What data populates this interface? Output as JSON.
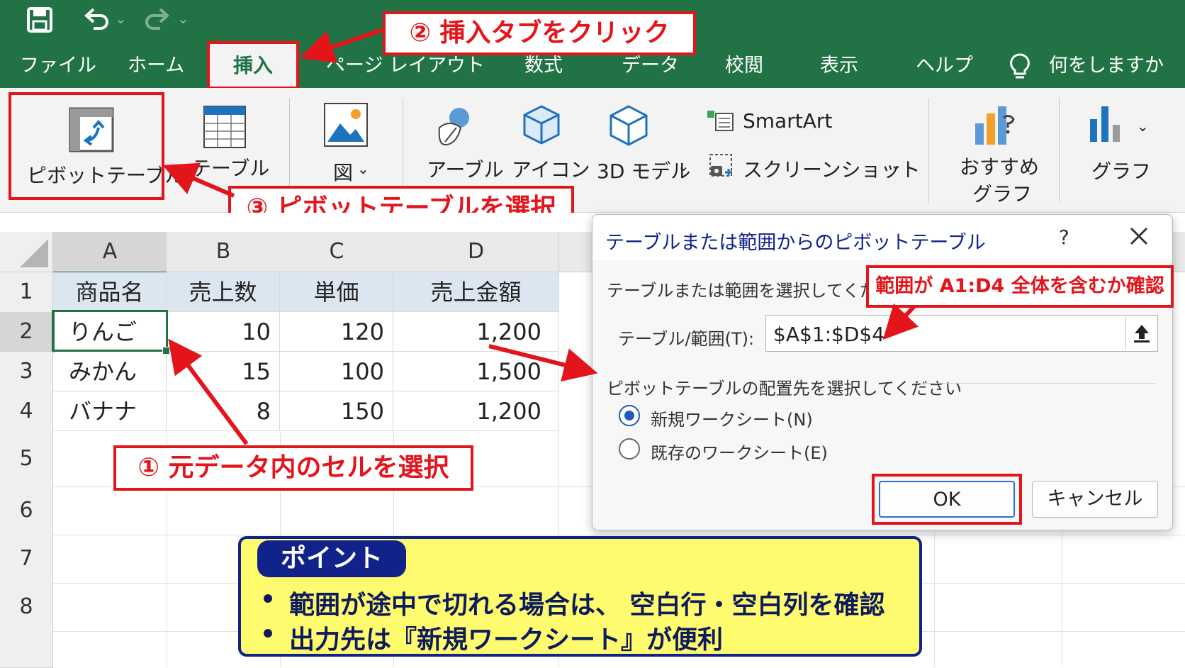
{
  "titlebar": {
    "icons": [
      "save-icon",
      "undo-icon",
      "redo-icon"
    ]
  },
  "tabs": [
    "ファイル",
    "ホーム",
    "挿入",
    "ページ レイアウト",
    "数式",
    "データ",
    "校閲",
    "表示",
    "ヘルプ"
  ],
  "tell_me": "何をしますか",
  "ribbon": {
    "pivot_table": "ピボットテーブル",
    "table": "テーブル",
    "picture": "図",
    "shapes": "アーブル",
    "icons": "アイコン",
    "model3d": "3D モデル",
    "smartart": "SmartArt",
    "screenshot": "スクリーンショット",
    "recommended_charts_line1": "おすすめ",
    "recommended_charts_line2": "グラフ",
    "charts": "グラフ"
  },
  "sheet": {
    "columns": [
      "A",
      "B",
      "C",
      "D"
    ],
    "rows": [
      "1",
      "2",
      "3",
      "4",
      "5",
      "6",
      "7",
      "8"
    ],
    "header": [
      "商品名",
      "売上数",
      "単価",
      "売上金額"
    ],
    "data": [
      [
        "りんご",
        "10",
        "120",
        "1,200"
      ],
      [
        "みかん",
        "15",
        "100",
        "1,500"
      ],
      [
        "バナナ",
        "8",
        "150",
        "1,200"
      ]
    ]
  },
  "dialog": {
    "title": "テーブルまたは範囲からのピボットテーブル",
    "help": "?",
    "close": "X",
    "select_prompt": "テーブルまたは範囲を選択してください",
    "range_label": "テーブル/範囲(T):",
    "range_value": "$A$1:$D$4",
    "placement_prompt": "ピボットテーブルの配置先を選択してください",
    "option_new": "新規ワークシート(N)",
    "option_existing": "既存のワークシート(E)",
    "ok": "OK",
    "cancel": "キャンセル"
  },
  "annotations": {
    "step1": "① 元データ内のセルを選択",
    "step2": "② 挿入タブをクリック",
    "step3": "③ ピボットテーブルを選択",
    "range_check": "範囲が A1:D4 全体を含むか確認"
  },
  "point": {
    "title": "ポイント",
    "line1": "範囲が途中で切れる場合は、 空白行・空白列を確認",
    "line2": "出力先は『新規ワークシート』が便利"
  },
  "colors": {
    "excel_green": "#217346",
    "annotation_red": "#e4141b",
    "point_bg": "#fffb6e",
    "point_border": "#11228a"
  }
}
